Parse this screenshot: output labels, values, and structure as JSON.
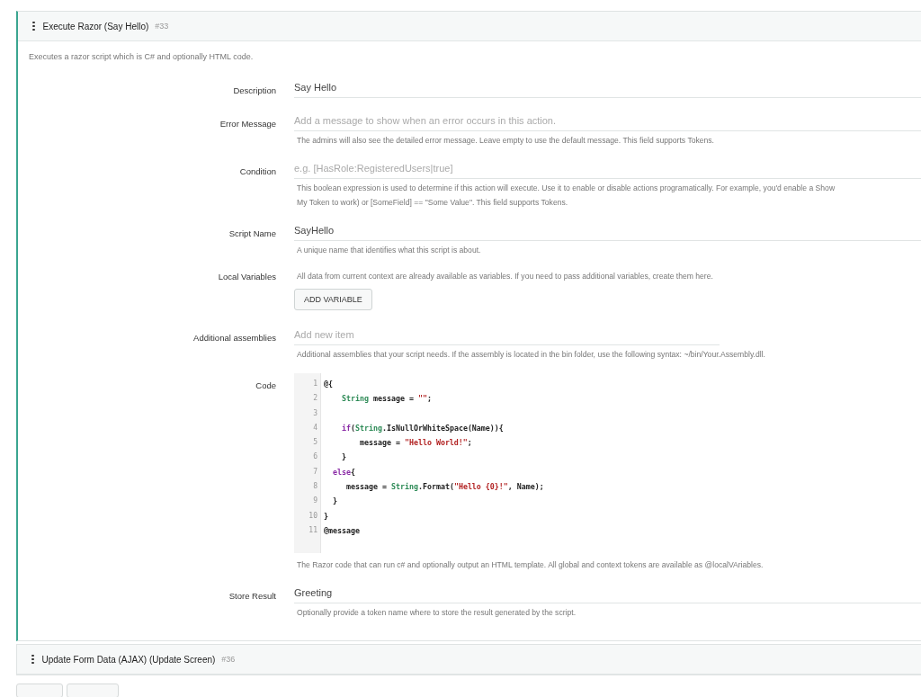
{
  "action_card": {
    "title": "Execute Razor (Say Hello)",
    "number": "#33",
    "expanded": true,
    "description": "Executes a razor script which is C# and optionally HTML code.",
    "fields": [
      {
        "kind": "text",
        "label": "Description",
        "value": "Say Hello"
      },
      {
        "kind": "text",
        "label": "Error Message",
        "placeholder": "Add a message to show when an error occurs in this action.",
        "help": [
          "The admins will also see the detailed error message. Leave empty to use the default message. This field supports Tokens."
        ]
      },
      {
        "kind": "text",
        "label": "Condition",
        "placeholder": "e.g. [HasRole:RegisteredUsers|true]",
        "help": [
          "This boolean expression is used to determine if this action will execute. Use it to enable or disable actions programatically. For example, you'd enable a Show",
          "My Token to work) or [SomeField] == \"Some Value\". This field supports Tokens."
        ]
      },
      {
        "kind": "text",
        "label": "Script Name",
        "value": "SayHello",
        "help": [
          "A unique name that identifies what this script is about."
        ]
      },
      {
        "kind": "variables",
        "label": "Local Variables",
        "help": [
          "All data from current context are already available as variables. If you need to pass additional variables, create them here."
        ],
        "button": "ADD VARIABLE"
      },
      {
        "kind": "list",
        "label": "Additional assemblies",
        "placeholder": "Add new item",
        "help": [
          "Additional assemblies that your script needs. If the assembly is located in the bin folder, use the following syntax: ~/bin/Your.Assembly.dll."
        ]
      },
      {
        "kind": "code",
        "label": "Code",
        "code": [
          {
            "number": "1",
            "tokens": [
              {
                "kind": "plain",
                "text": "@{"
              }
            ]
          },
          {
            "number": "2",
            "tokens": [
              {
                "kind": "type",
                "text": "    String"
              },
              {
                "kind": "plain",
                "text": " message = "
              },
              {
                "kind": "string",
                "text": "\"\""
              },
              {
                "kind": "plain",
                "text": ";"
              }
            ]
          },
          {
            "number": "3"
          },
          {
            "number": "4",
            "tokens": [
              {
                "kind": "keyword",
                "text": "    if"
              },
              {
                "kind": "plain",
                "text": "("
              },
              {
                "kind": "type",
                "text": "String"
              },
              {
                "kind": "plain",
                "text": ".IsNullOrWhiteSpace(Name)){"
              }
            ]
          },
          {
            "number": "5",
            "tokens": [
              {
                "kind": "plain",
                "text": "        message = "
              },
              {
                "kind": "string",
                "text": "\"Hello World!\""
              },
              {
                "kind": "plain",
                "text": ";"
              }
            ]
          },
          {
            "number": "6",
            "tokens": [
              {
                "kind": "plain",
                "text": "    }"
              }
            ]
          },
          {
            "number": "7",
            "tokens": [
              {
                "kind": "keyword",
                "text": "  else"
              },
              {
                "kind": "plain",
                "text": "{"
              }
            ]
          },
          {
            "number": "8",
            "tokens": [
              {
                "kind": "plain",
                "text": "     message = "
              },
              {
                "kind": "type",
                "text": "String"
              },
              {
                "kind": "plain",
                "text": ".Format("
              },
              {
                "kind": "string",
                "text": "\"Hello {0}!\""
              },
              {
                "kind": "plain",
                "text": ", Name);"
              }
            ]
          },
          {
            "number": "9",
            "tokens": [
              {
                "kind": "plain",
                "text": "  }"
              }
            ]
          },
          {
            "number": "10",
            "tokens": [
              {
                "kind": "plain",
                "text": "}"
              }
            ]
          },
          {
            "number": "11",
            "tokens": [
              {
                "kind": "plain",
                "text": "@message"
              }
            ]
          }
        ],
        "help": [
          "The Razor code that can run c# and optionally output an HTML template. All global and context tokens are available as @localVAriables."
        ]
      },
      {
        "kind": "text",
        "label": "Store Result",
        "value": "Greeting",
        "help": [
          "Optionally provide a token name where to store the result generated by the script."
        ]
      }
    ]
  },
  "next_card": {
    "title": "Update Form Data (AJAX) (Update Screen)",
    "number": "#36",
    "expanded": false
  }
}
